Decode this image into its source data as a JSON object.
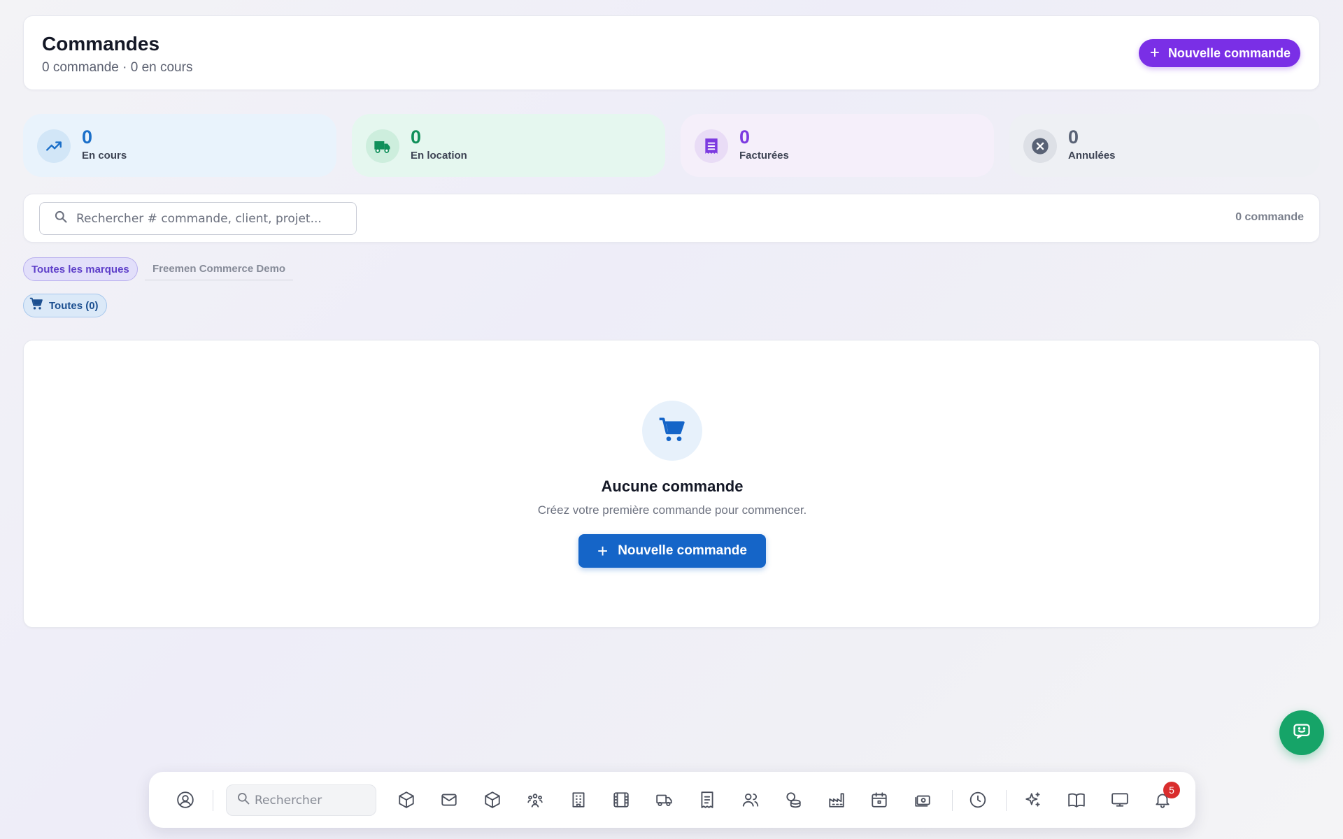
{
  "header": {
    "title": "Commandes",
    "subtitle": "0 commande · 0 en cours",
    "new_order_label": "Nouvelle commande"
  },
  "stats": [
    {
      "value": "0",
      "label": "En cours",
      "icon": "trending-up-icon",
      "color": "#1b6fc9"
    },
    {
      "value": "0",
      "label": "En location",
      "icon": "truck-icon",
      "color": "#10905a"
    },
    {
      "value": "0",
      "label": "Facturées",
      "icon": "receipt-icon",
      "color": "#7c3ae0"
    },
    {
      "value": "0",
      "label": "Annulées",
      "icon": "cancel-icon",
      "color": "#596275"
    }
  ],
  "search": {
    "placeholder": "Rechercher # commande, client, projet...",
    "value": "",
    "count_label": "0 commande"
  },
  "filters": {
    "brands": [
      "Toutes les marques",
      "Freemen Commerce Demo"
    ],
    "selected_brand": "Toutes les marques",
    "order_status": "Toutes (0)"
  },
  "empty_state": {
    "icon": "cart-icon",
    "title": "Aucune commande",
    "subtitle": "Créez votre première commande pour commencer.",
    "button_label": "Nouvelle commande"
  },
  "dock": {
    "search_placeholder": "Rechercher",
    "items": [
      "user-circle-icon",
      "box-icon",
      "mail-icon",
      "package-icon",
      "team-icon",
      "building-icon",
      "film-icon",
      "truck-icon",
      "receipt-icon",
      "users-icon",
      "coins-icon",
      "factory-icon",
      "calendar-icon",
      "cash-icon",
      "clock-icon",
      "sparkles-icon",
      "book-icon",
      "monitor-icon",
      "bell-icon"
    ],
    "notification_count": "5"
  },
  "colors": {
    "primary_purple": "#7a2fe6",
    "primary_blue": "#1565c8",
    "chat_green": "#16a468",
    "badge_red": "#d92d2d"
  }
}
